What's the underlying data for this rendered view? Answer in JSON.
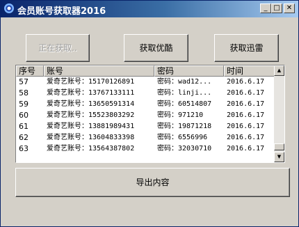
{
  "window": {
    "title": "会员账号获取器2016"
  },
  "titlebar_buttons": {
    "min": "_",
    "max": "□",
    "close": "✕"
  },
  "buttons": {
    "fetching": "正在获取..",
    "youku": "获取优酷",
    "xunlei": "获取迅雷",
    "export": "导出内容"
  },
  "table": {
    "columns": [
      "序号",
      "账号",
      "密码",
      "时间"
    ],
    "rows": [
      [
        "57",
        "爱奇艺账号：15170126891",
        "密码：wad12...",
        "2016.6.17"
      ],
      [
        "58",
        "爱奇艺账号：13767133111",
        "密码：linji...",
        "2016.6.17"
      ],
      [
        "59",
        "爱奇艺账号：13650591314",
        "密码：60514807",
        "2016.6.17"
      ],
      [
        "60",
        "爱奇艺账号：15523803292",
        "密码：971210",
        "2016.6.17"
      ],
      [
        "61",
        "爱奇艺账号：13881989431",
        "密码：19871218",
        "2016.6.17"
      ],
      [
        "62",
        "爱奇艺账号：13604833398",
        "密码：6556996",
        "2016.6.17"
      ],
      [
        "63",
        "爱奇艺账号：13564387802",
        "密码：32030710",
        "2016.6.17"
      ]
    ]
  },
  "scrollbar": {
    "position": 0.9
  }
}
